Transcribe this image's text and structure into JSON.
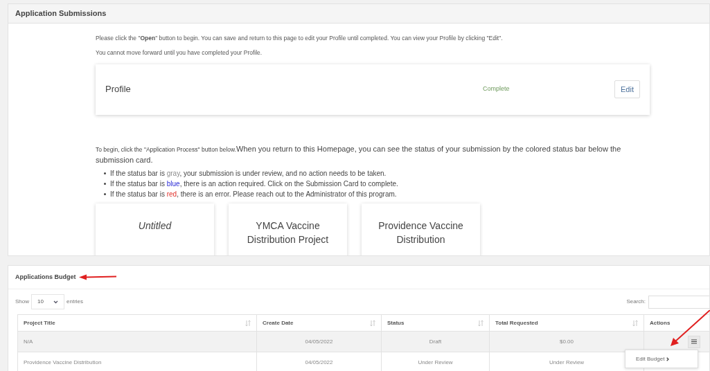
{
  "submissions": {
    "title": "Application Submissions",
    "intro": "Please click the \"**Open**\" button to begin. You can save and return to this page to edit your Profile until completed. You can view your Profile by clicking \"Edit\".",
    "note": "You cannot move forward until you have completed your Profile.",
    "profile": {
      "name": "Profile",
      "status": "Complete",
      "button": "Edit"
    },
    "instructions_lead": "To begin, click the \"Application Process\" button below.",
    "instructions_rest": "When you return to this Homepage, you can see the status of your submission by the colored status bar below the submission card.",
    "bullets": [
      {
        "before": "If the status bar is ",
        "word": "gray",
        "kind": "neutral",
        "after": ", your submission is under review, and no action needs to be taken."
      },
      {
        "before": "If the status bar is ",
        "word": "blue",
        "kind": "action",
        "after": ", there is an action required. Click on the Submission Card to complete."
      },
      {
        "before": "If the status bar is ",
        "word": "red",
        "kind": "error",
        "after": ", there is an error. Please reach out to the Administrator of this program."
      }
    ],
    "cards": [
      {
        "title": "Untitled",
        "italic": true
      },
      {
        "title": "YMCA Vaccine Distribution Project",
        "italic": false
      },
      {
        "title": "Providence Vaccine Distribution",
        "italic": false
      }
    ]
  },
  "budget": {
    "title": "Applications Budget",
    "show_label": "Show",
    "page_size": "10",
    "entries_label": "entries",
    "search_label": "Search:",
    "columns": [
      "Project Title",
      "Create Date",
      "Status",
      "Total Requested",
      "Actions"
    ],
    "rows": [
      {
        "project_title": "N/A",
        "create_date": "04/05/2022",
        "status": "Draft",
        "total_requested": "$0.00"
      },
      {
        "project_title": "Providence Vaccine Distribution",
        "create_date": "04/05/2022",
        "status": "Under Review",
        "total_requested": "Under Review"
      }
    ],
    "menu": {
      "item": "Edit Budget"
    }
  }
}
